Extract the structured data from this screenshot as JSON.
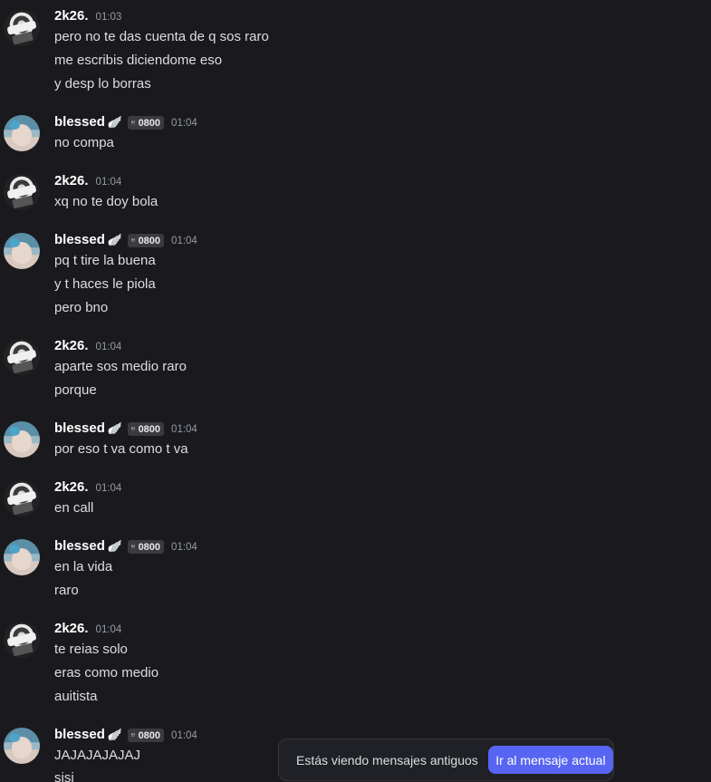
{
  "messages": [
    {
      "author": "2k26.",
      "time": "01:03",
      "lines": [
        "pero no te das cuenta de q sos raro",
        "me escribis diciendome eso",
        "y desp lo borras"
      ]
    },
    {
      "author": "blessed",
      "decor": "🪽",
      "tag": "0800",
      "time": "01:04",
      "lines": [
        "no compa"
      ]
    },
    {
      "author": "2k26.",
      "time": "01:04",
      "lines": [
        "xq no te doy bola"
      ]
    },
    {
      "author": "blessed",
      "decor": "🪽",
      "tag": "0800",
      "time": "01:04",
      "lines": [
        "pq t tire la buena",
        "y t haces le piola",
        "pero bno"
      ]
    },
    {
      "author": "2k26.",
      "time": "01:04",
      "lines": [
        "aparte sos medio raro",
        "porque"
      ]
    },
    {
      "author": "blessed",
      "decor": "🪽",
      "tag": "0800",
      "time": "01:04",
      "lines": [
        "por eso t va como t va"
      ]
    },
    {
      "author": "2k26.",
      "time": "01:04",
      "lines": [
        "en call"
      ]
    },
    {
      "author": "blessed",
      "decor": "🪽",
      "tag": "0800",
      "time": "01:04",
      "lines": [
        "en la vida",
        "raro"
      ]
    },
    {
      "author": "2k26.",
      "time": "01:04",
      "lines": [
        "te reias solo",
        "eras como medio",
        "auitista"
      ]
    },
    {
      "author": "blessed",
      "decor": "🪽",
      "tag": "0800",
      "time": "01:04",
      "lines": [
        "JAJAJAJAJAJ",
        "sisi"
      ]
    }
  ],
  "jump_bar": {
    "text": "Estás viendo mensajes antiguos",
    "button_label": "Ir al mensaje actual"
  },
  "icons": {
    "tag_icon": "guild-tag-icon",
    "decor_icon": "wing-icon"
  },
  "colors": {
    "background": "#1a1a1e",
    "accent": "#5865f2",
    "username": "#ffffff",
    "timestamp": "#949ba4"
  }
}
